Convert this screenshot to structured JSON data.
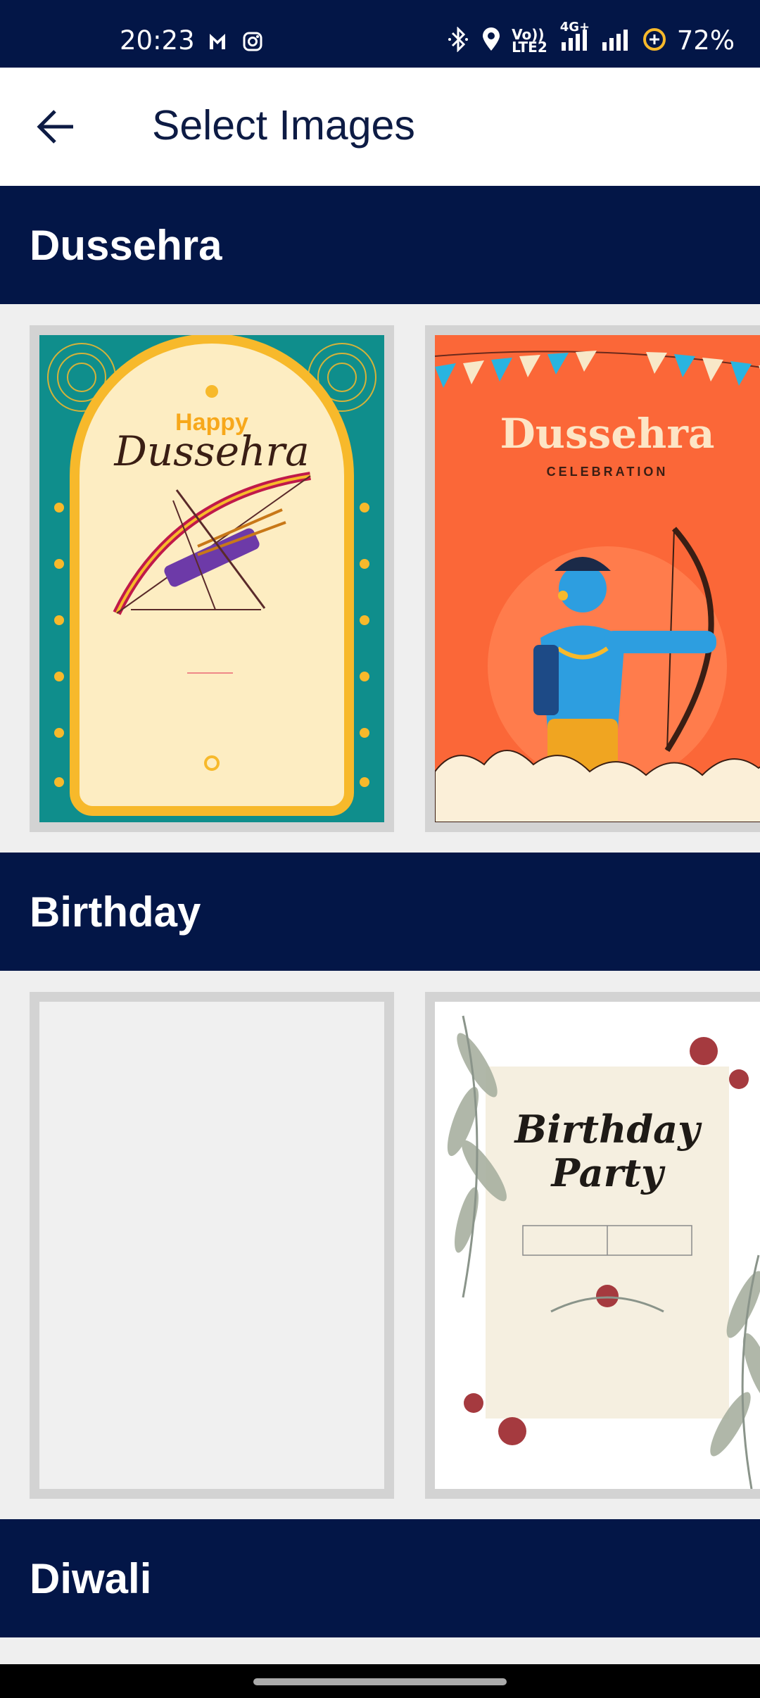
{
  "status_bar": {
    "time": "20:23",
    "battery": "72%",
    "network_label": "4G+",
    "volte_label_1": "Vo))",
    "volte_label_2": "LTE2",
    "icons": [
      "gmail-icon",
      "instagram-icon",
      "bluetooth-icon",
      "location-icon",
      "volte-icon",
      "signal-icon",
      "signal-icon",
      "battery-saver-icon"
    ]
  },
  "app_bar": {
    "title": "Select Images",
    "back_icon": "arrow-left-icon"
  },
  "sections": [
    {
      "title": "Dussehra",
      "cards": [
        {
          "heading_small": "Happy",
          "heading_script": "Dussehra"
        },
        {
          "heading": "Dussehra",
          "subheading": "CELEBRATION"
        }
      ]
    },
    {
      "title": "Birthday",
      "cards": [
        {
          "empty": true
        },
        {
          "heading_line1": "Birthday",
          "heading_line2": "Party"
        }
      ]
    },
    {
      "title": "Diwali"
    }
  ],
  "colors": {
    "navy": "#031647",
    "teal": "#0f8e8c",
    "orange": "#fb6738",
    "cream": "#fdedc2",
    "gold": "#f7b92b"
  }
}
